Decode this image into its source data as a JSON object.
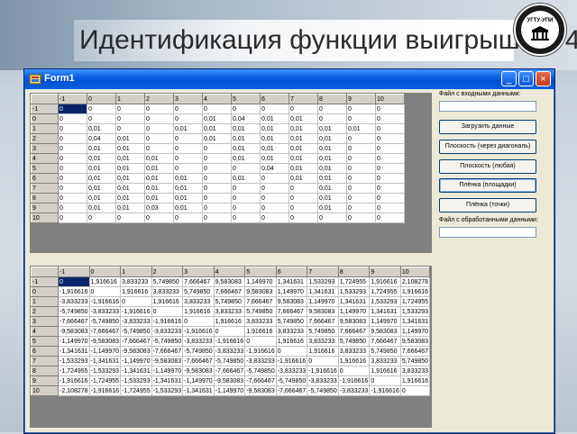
{
  "slide": {
    "title": "Идентификация функции выигрыша – 4",
    "logo_text": "УГТУ-УПИ"
  },
  "window": {
    "title": "Form1",
    "icon": "delphi-app-icon",
    "buttons": {
      "minimize": "_",
      "maximize": "□",
      "close": "×"
    }
  },
  "right_panel": {
    "input_file_label": "Файл с входными данными:",
    "input_file_value": "",
    "load_button": "Загрузить данные",
    "plane_diag_button": "Плоскость (через диагональ)",
    "plane_any_button": "Плоскость (любая)",
    "film_areas_button": "Плёнка (площадки)",
    "film_points_button": "Плёнка (точки)",
    "output_file_label": "Файл с обработанными данными:",
    "output_file_value": ""
  },
  "grid_top": {
    "headers": [
      "",
      "-1",
      "0",
      "1",
      "2",
      "3",
      "4",
      "5",
      "6",
      "7",
      "8",
      "9",
      "10"
    ],
    "rows": [
      [
        "-1",
        "0",
        "0",
        "0",
        "0",
        "0",
        "0",
        "0",
        "0",
        "0",
        "0",
        "0",
        "0"
      ],
      [
        "0",
        "0",
        "0",
        "0",
        "0",
        "0",
        "0,01",
        "0,04",
        "0,01",
        "0,01",
        "0",
        "0",
        "0"
      ],
      [
        "1",
        "0",
        "0,01",
        "0",
        "0",
        "0,01",
        "0,01",
        "0,01",
        "0,01",
        "0,01",
        "0,01",
        "0,01",
        "0"
      ],
      [
        "2",
        "0",
        "0,04",
        "0,01",
        "0",
        "0",
        "0,01",
        "0,01",
        "0,01",
        "0,01",
        "0,01",
        "0",
        "0"
      ],
      [
        "3",
        "0",
        "0,01",
        "0,01",
        "0",
        "0",
        "0",
        "0,01",
        "0,01",
        "0,01",
        "0,01",
        "0",
        "0"
      ],
      [
        "4",
        "0",
        "0,01",
        "0,01",
        "0,01",
        "0",
        "0",
        "0,01",
        "0,01",
        "0,01",
        "0,01",
        "0",
        "0"
      ],
      [
        "5",
        "0",
        "0,01",
        "0,01",
        "0,01",
        "0",
        "0",
        "0",
        "0,04",
        "0,01",
        "0,01",
        "0",
        "0"
      ],
      [
        "6",
        "0",
        "0,01",
        "0,01",
        "0,01",
        "0,01",
        "0",
        "0,01",
        "0",
        "0,01",
        "0,01",
        "0",
        "0"
      ],
      [
        "7",
        "0",
        "0,01",
        "0,01",
        "0,01",
        "0,01",
        "0",
        "0",
        "0",
        "0",
        "0,01",
        "0",
        "0"
      ],
      [
        "8",
        "0",
        "0,01",
        "0,01",
        "0,01",
        "0,01",
        "0",
        "0",
        "0",
        "0",
        "0,01",
        "0",
        "0"
      ],
      [
        "9",
        "0",
        "0,01",
        "0,01",
        "0,03",
        "0,01",
        "0",
        "0",
        "0",
        "0",
        "0,01",
        "0",
        "0"
      ],
      [
        "10",
        "0",
        "0",
        "0",
        "0",
        "0",
        "0",
        "0",
        "0",
        "0",
        "0",
        "0",
        "0"
      ]
    ]
  },
  "grid_bottom": {
    "headers": [
      "",
      "-1",
      "0",
      "1",
      "2",
      "3",
      "4",
      "5",
      "6",
      "7",
      "8",
      "9",
      "10"
    ],
    "rows": [
      [
        "-1",
        "0",
        "1,916616",
        "3,833233",
        "5,749850",
        "7,666467",
        "9,583083",
        "1,149970",
        "1,341631",
        "1,533293",
        "1,724955",
        "1,916616",
        "2,108278"
      ],
      [
        "0",
        "-1,916616",
        "0",
        "1,916616",
        "3,833233",
        "5,749850",
        "7,666467",
        "9,583083",
        "1,149970",
        "1,341631",
        "1,533293",
        "1,724955",
        "1,916616"
      ],
      [
        "1",
        "-3,833233",
        "-1,916616",
        "0",
        "1,916616",
        "3,833233",
        "5,749850",
        "7,666467",
        "9,583083",
        "1,149970",
        "1,341631",
        "1,533293",
        "1,724955"
      ],
      [
        "2",
        "-5,749850",
        "-3,833233",
        "-1,916616",
        "0",
        "1,916616",
        "3,833233",
        "5,749850",
        "7,666467",
        "9,583083",
        "1,149970",
        "1,341631",
        "1,533293"
      ],
      [
        "3",
        "-7,666467",
        "-5,749850",
        "-3,833233",
        "-1,916616",
        "0",
        "1,916616",
        "3,833233",
        "5,749850",
        "7,666467",
        "9,583083",
        "1,149970",
        "1,341631"
      ],
      [
        "4",
        "-9,583083",
        "-7,666467",
        "-5,749850",
        "-3,833233",
        "-1,916616",
        "0",
        "1,916616",
        "3,833233",
        "5,749850",
        "7,666467",
        "9,583083",
        "1,149970"
      ],
      [
        "5",
        "-1,149970",
        "-9,583083",
        "-7,666467",
        "-5,749850",
        "-3,833233",
        "-1,916616",
        "0",
        "1,916616",
        "3,833233",
        "5,749850",
        "7,666467",
        "9,583083"
      ],
      [
        "6",
        "-1,341631",
        "-1,149970",
        "-9,583083",
        "-7,666467",
        "-5,749850",
        "-3,833233",
        "-1,916616",
        "0",
        "1,916616",
        "3,833233",
        "5,749850",
        "7,666467"
      ],
      [
        "7",
        "-1,533293",
        "-1,341631",
        "-1,149970",
        "-9,583083",
        "-7,666467",
        "-5,749850",
        "-3,833233",
        "-1,916616",
        "0",
        "1,916616",
        "3,833233",
        "5,749850"
      ],
      [
        "8",
        "-1,724955",
        "-1,533293",
        "-1,341631",
        "-1,149970",
        "-9,583083",
        "-7,666467",
        "-5,749850",
        "-3,833233",
        "-1,916616",
        "0",
        "1,916616",
        "3,833233"
      ],
      [
        "9",
        "-1,916616",
        "-1,724955",
        "-1,533293",
        "-1,341631",
        "-1,149970",
        "-9,583083",
        "-7,666467",
        "-5,749850",
        "-3,833233",
        "-1,916616",
        "0",
        "1,916616"
      ],
      [
        "10",
        "-2,108278",
        "-1,916616",
        "-1,724955",
        "-1,533293",
        "-1,341631",
        "-1,149970",
        "-9,583083",
        "-7,666467",
        "-5,749850",
        "-3,833233",
        "-1,916616",
        "0"
      ]
    ]
  }
}
